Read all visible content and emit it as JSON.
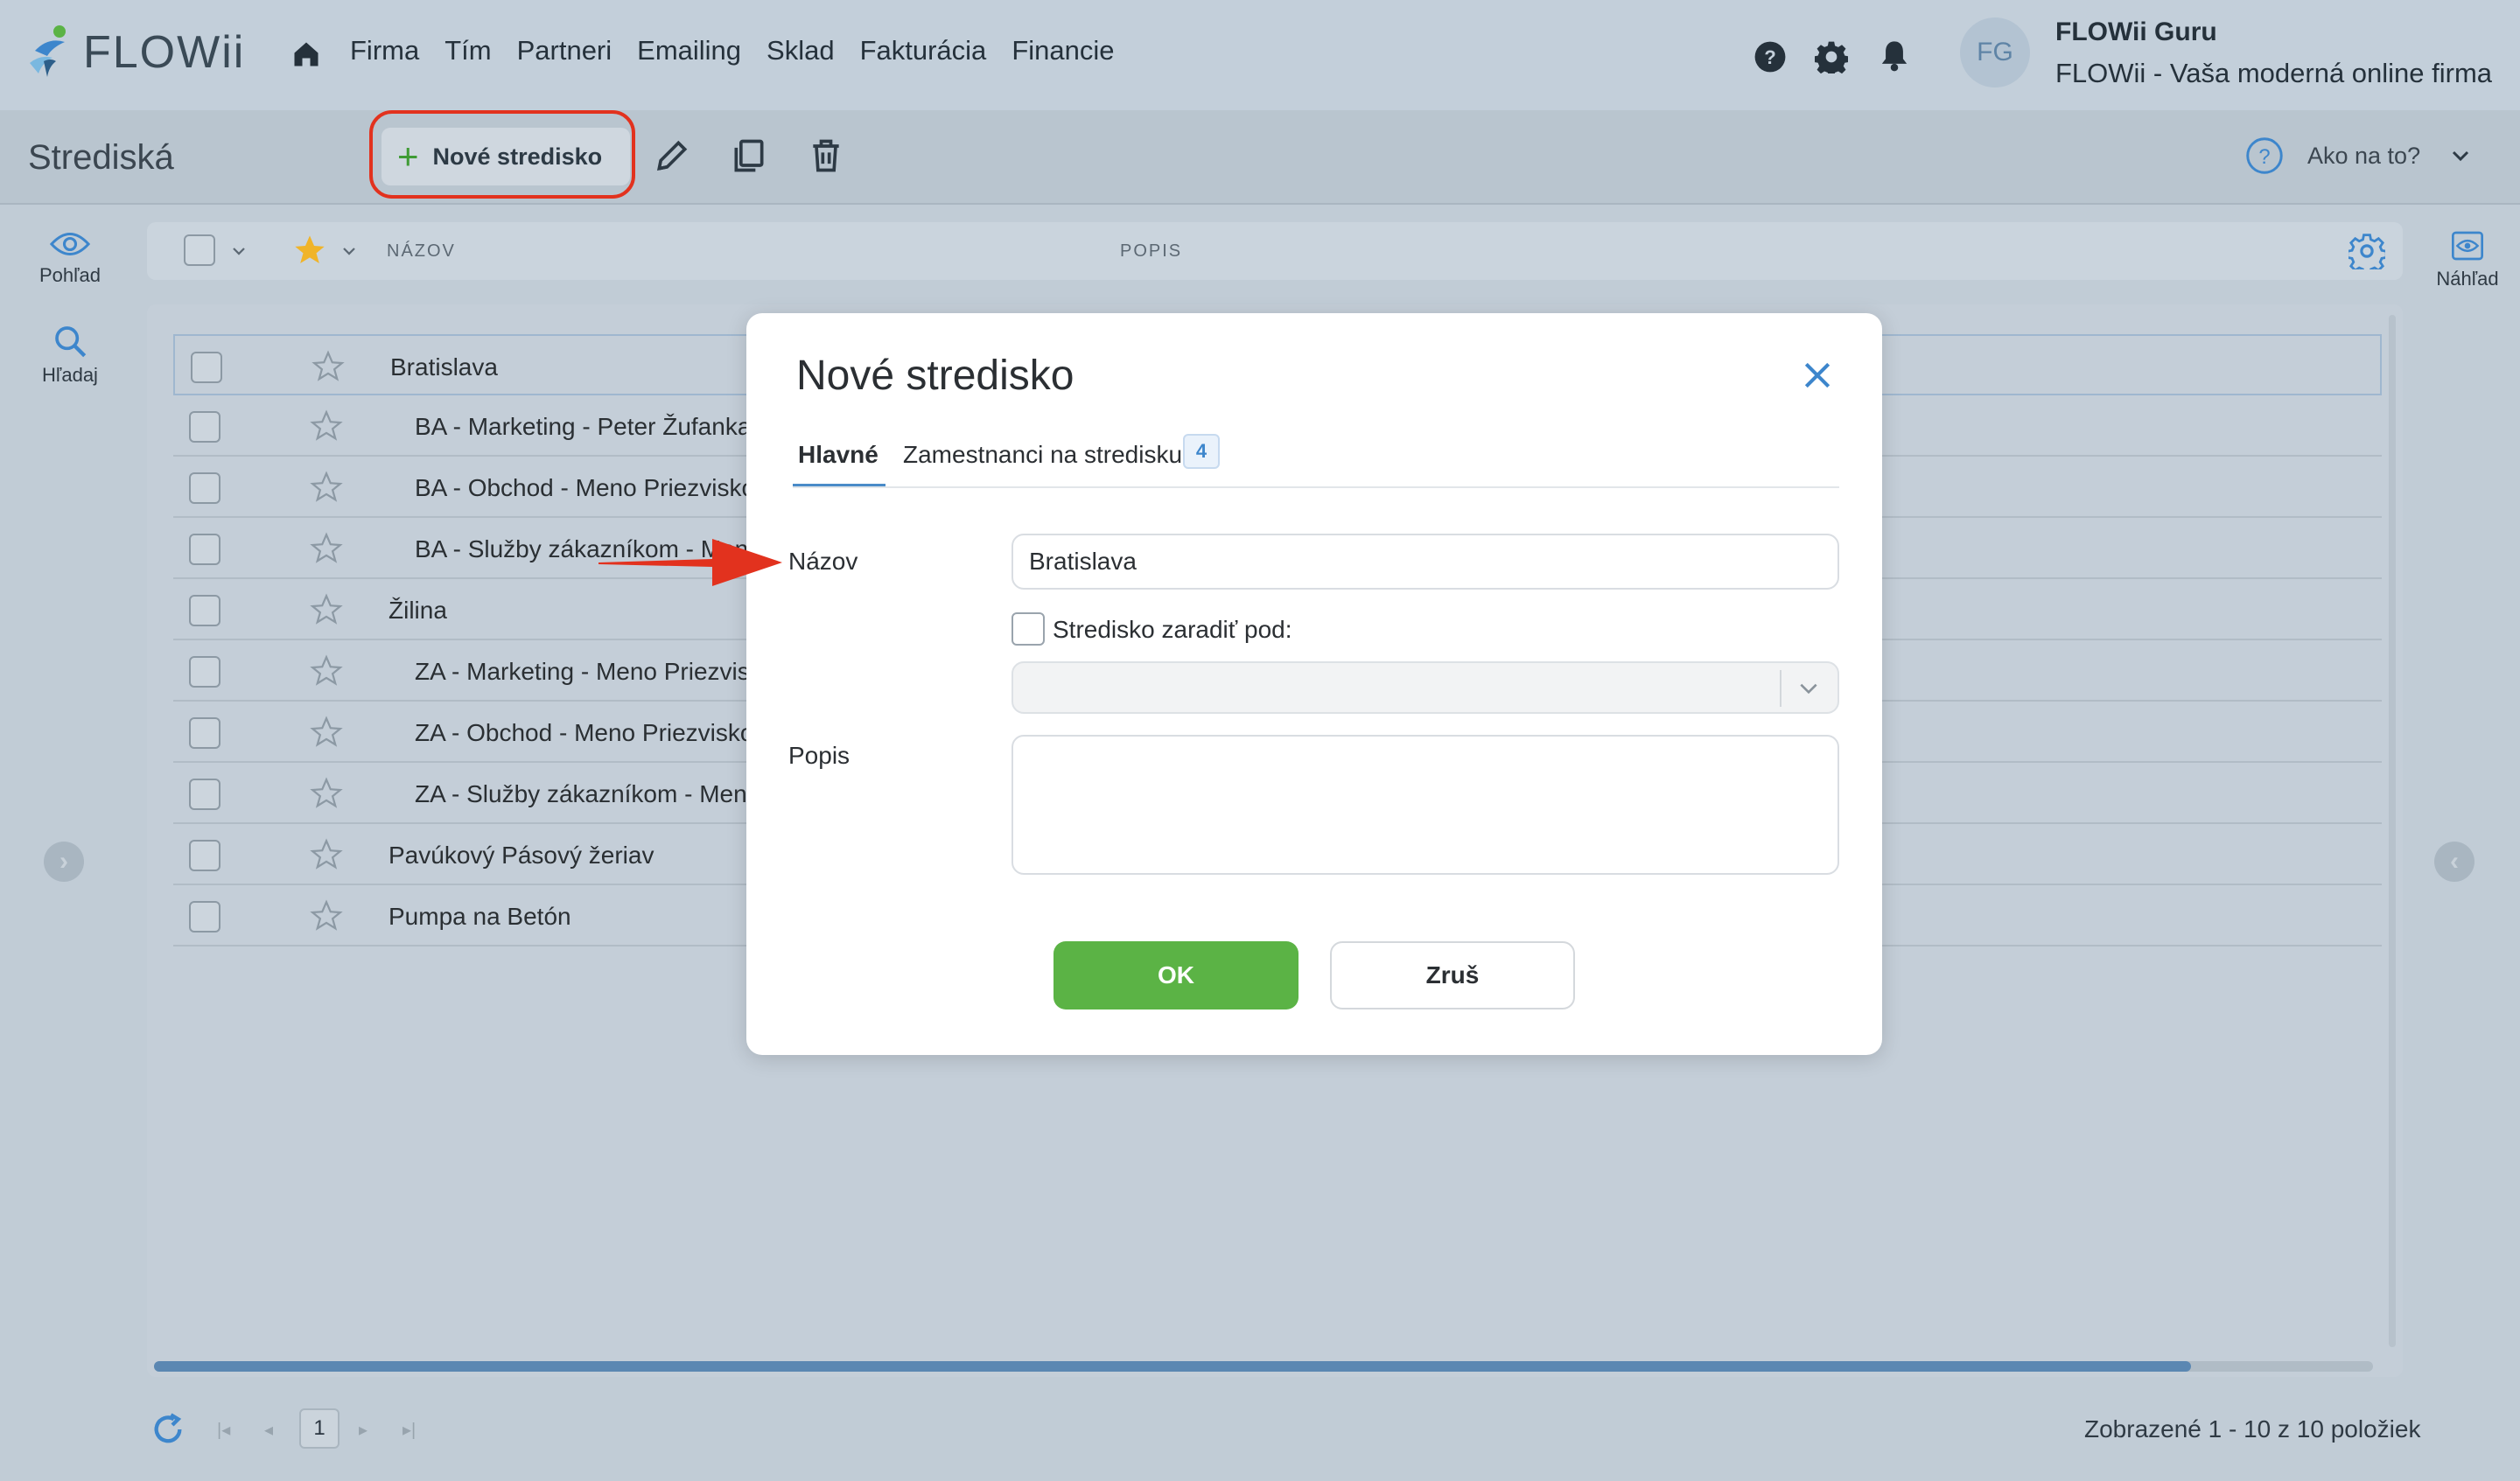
{
  "app": {
    "brand": "FLOWii",
    "nav": [
      "Firma",
      "Tím",
      "Partneri",
      "Emailing",
      "Sklad",
      "Fakturácia",
      "Financie"
    ],
    "user": {
      "initials": "FG",
      "name": "FLOWii Guru",
      "company": "FLOWii - Vaša moderná online firma"
    }
  },
  "toolbar": {
    "page_title": "Strediská",
    "new_button": "Nové stredisko",
    "help_label": "Ako na to?"
  },
  "sidebar_left": {
    "view": "Pohľad",
    "search": "Hľadaj"
  },
  "sidebar_right": {
    "preview": "Náhľad"
  },
  "grid": {
    "columns": [
      "NÁZOV",
      "POPIS"
    ],
    "rows": [
      {
        "name": "Bratislava",
        "level": 0
      },
      {
        "name": "BA - Marketing - Peter Žufanka",
        "level": 1
      },
      {
        "name": "BA - Obchod - Meno Priezvisko",
        "level": 1
      },
      {
        "name": "BA - Služby zákazníkom - Meno",
        "level": 1
      },
      {
        "name": "Žilina",
        "level": 0
      },
      {
        "name": "ZA - Marketing - Meno Priezvisko",
        "level": 1
      },
      {
        "name": "ZA - Obchod - Meno Priezvisko",
        "level": 1
      },
      {
        "name": "ZA - Služby zákazníkom - Meno",
        "level": 1
      },
      {
        "name": "Pavúkový Pásový žeriav",
        "level": 0
      },
      {
        "name": "Pumpa na Betón",
        "level": 0
      }
    ]
  },
  "pager": {
    "page": "1",
    "summary": "Zobrazené 1 - 10 z 10 položiek"
  },
  "modal": {
    "title": "Nové stredisko",
    "tabs": [
      {
        "label": "Hlavné"
      },
      {
        "label": "Zamestnanci na stredisku",
        "badge": "4"
      }
    ],
    "name_label": "Názov",
    "name_value": "Bratislava",
    "parent_checkbox_label": "Stredisko zaradiť pod:",
    "parent_value": "",
    "description_label": "Popis",
    "description_value": "",
    "ok": "OK",
    "cancel": "Zruš"
  },
  "colors": {
    "accent": "#4a8bc8",
    "ok_green": "#5bb345",
    "highlight_red": "#e2321e"
  }
}
